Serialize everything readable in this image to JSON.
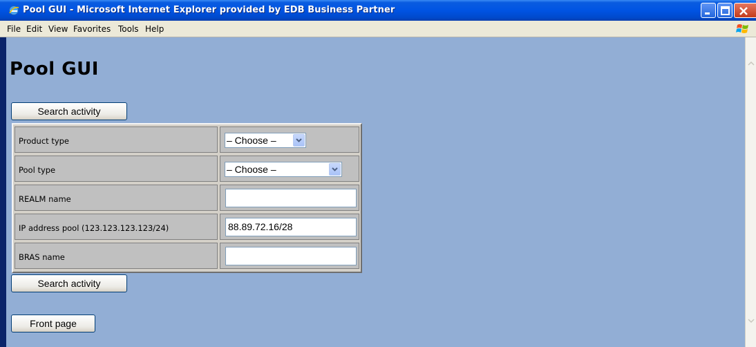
{
  "window": {
    "title": "Pool GUI - Microsoft Internet Explorer provided by EDB Business Partner",
    "icon": "ie-icon"
  },
  "menubar": {
    "items": [
      {
        "label": "File"
      },
      {
        "label": "Edit"
      },
      {
        "label": "View"
      },
      {
        "label": "Favorites"
      },
      {
        "label": "Tools"
      },
      {
        "label": "Help"
      }
    ]
  },
  "page": {
    "title": "Pool GUI",
    "search_button_top": "Search activity",
    "search_button_bottom": "Search activity",
    "front_page_button": "Front page"
  },
  "form": {
    "rows": [
      {
        "label": "Product type",
        "type": "select",
        "value": "– Choose –"
      },
      {
        "label": "Pool type",
        "type": "select",
        "value": "– Choose –"
      },
      {
        "label": "REALM name",
        "type": "text",
        "value": ""
      },
      {
        "label": "IP address pool (123.123.123.123/24)",
        "type": "text",
        "value": "88.89.72.16/28"
      },
      {
        "label": "BRAS name",
        "type": "text",
        "value": ""
      }
    ]
  },
  "colors": {
    "page_background": "#92aed5",
    "titlebar": "#0054e3",
    "table_background": "#c0c0c0"
  }
}
